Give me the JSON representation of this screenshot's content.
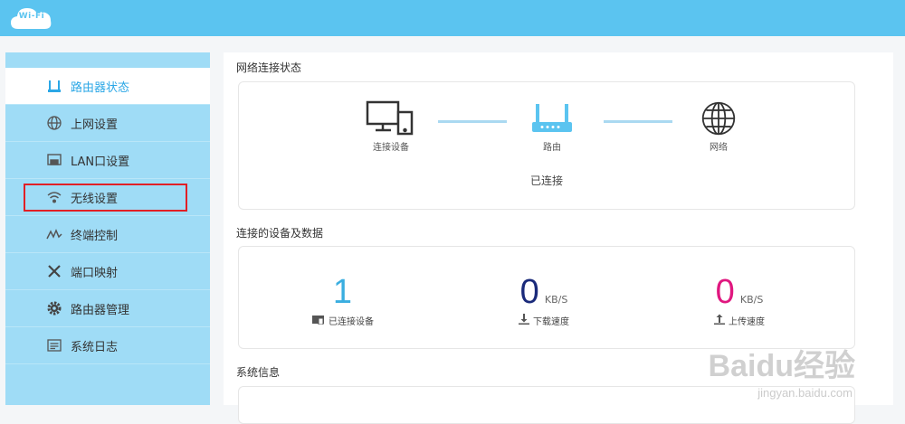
{
  "header": {
    "logo_text": "Wi-Fi"
  },
  "sidebar": {
    "items": [
      {
        "label": "路由器状态",
        "icon": "router-icon",
        "active": true
      },
      {
        "label": "上网设置",
        "icon": "globe-icon",
        "active": false
      },
      {
        "label": "LAN口设置",
        "icon": "lan-port-icon",
        "active": false
      },
      {
        "label": "无线设置",
        "icon": "wifi-icon",
        "active": false,
        "highlighted": true
      },
      {
        "label": "终端控制",
        "icon": "activity-icon",
        "active": false
      },
      {
        "label": "端口映射",
        "icon": "tools-icon",
        "active": false
      },
      {
        "label": "路由器管理",
        "icon": "gear-icon",
        "active": false
      },
      {
        "label": "系统日志",
        "icon": "log-icon",
        "active": false
      }
    ]
  },
  "main": {
    "network_status": {
      "title": "网络连接状态",
      "nodes": [
        {
          "label": "连接设备",
          "icon": "devices-icon"
        },
        {
          "label": "路由",
          "icon": "router-icon"
        },
        {
          "label": "网络",
          "icon": "globe-icon"
        }
      ],
      "status_text": "已连接"
    },
    "devices_data": {
      "title": "连接的设备及数据",
      "stats": [
        {
          "value": "1",
          "unit": "",
          "label": "已连接设备",
          "color": "#3aaee0",
          "icon": "device-icon"
        },
        {
          "value": "0",
          "unit": "KB/S",
          "label": "下载速度",
          "color": "#1a2a7a",
          "icon": "download-icon"
        },
        {
          "value": "0",
          "unit": "KB/S",
          "label": "上传速度",
          "color": "#e0177f",
          "icon": "upload-icon"
        }
      ]
    },
    "system_info": {
      "title": "系统信息"
    }
  },
  "watermark": {
    "brand": "Baidu经验",
    "url": "jingyan.baidu.com"
  },
  "colors": {
    "header": "#5bc4f0",
    "sidebar": "#9fdcf6",
    "accent": "#2ba7e6",
    "highlight": "#e11f25"
  }
}
